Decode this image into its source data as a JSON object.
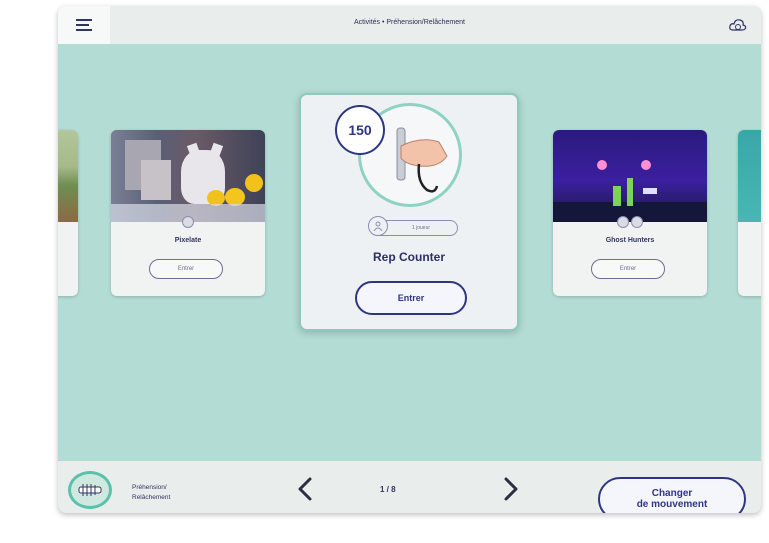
{
  "header": {
    "title": "Activités • Préhension/Relâchement",
    "menu_icon": "hamburger-icon",
    "cloud_icon": "cloud-sync-icon"
  },
  "carousel": {
    "left_card": {
      "name": "Pixelate",
      "button": "Entrer"
    },
    "center_card": {
      "count": "150",
      "players": "1 joueur",
      "name": "Rep Counter",
      "button": "Entrer"
    },
    "right_card": {
      "name": "Ghost Hunters",
      "button": "Entrer"
    }
  },
  "footer": {
    "movement_line1": "Préhension/",
    "movement_line2": "Relâchement",
    "page": "1 / 8",
    "change_line1": "Changer",
    "change_line2": "de mouvement"
  },
  "colors": {
    "background": "#b3ddd4",
    "accent": "#2f3582",
    "teal": "#5cc1aa"
  }
}
